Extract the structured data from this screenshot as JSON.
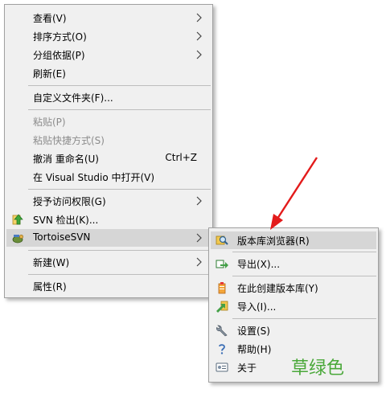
{
  "main_menu": {
    "items": [
      {
        "label": "查看(V)"
      },
      {
        "label": "排序方式(O)"
      },
      {
        "label": "分组依据(P)"
      },
      {
        "label": "刷新(E)"
      },
      {
        "label": "自定义文件夹(F)..."
      },
      {
        "label": "粘贴(P)"
      },
      {
        "label": "粘贴快捷方式(S)"
      },
      {
        "label": "撤消 重命名(U)",
        "shortcut": "Ctrl+Z"
      },
      {
        "label": "在 Visual Studio 中打开(V)"
      },
      {
        "label": "授予访问权限(G)"
      },
      {
        "label": "SVN 检出(K)..."
      },
      {
        "label": "TortoiseSVN"
      },
      {
        "label": "新建(W)"
      },
      {
        "label": "属性(R)"
      }
    ]
  },
  "svn_submenu": {
    "items": [
      {
        "label": "版本库浏览器(R)"
      },
      {
        "label": "导出(X)..."
      },
      {
        "label": "在此创建版本库(Y)"
      },
      {
        "label": "导入(I)..."
      },
      {
        "label": "设置(S)"
      },
      {
        "label": "帮助(H)"
      },
      {
        "label": "关于"
      }
    ]
  },
  "annotation": {
    "text": "草绿色",
    "color": "#4aa83a"
  },
  "colors": {
    "menu_bg": "#f0f0f0",
    "highlight": "#d6d6d6",
    "disabled_text": "#8c8c8c",
    "arrow": "#e31b1b"
  },
  "icons": {
    "svn_checkout": "svn-checkout-icon",
    "tortoise": "tortoisesvn-icon",
    "repo_browser": "repo-browser-icon",
    "export": "export-icon",
    "create_repo": "create-repository-icon",
    "import": "import-icon",
    "settings": "settings-icon",
    "help": "help-icon",
    "about": "about-icon"
  }
}
